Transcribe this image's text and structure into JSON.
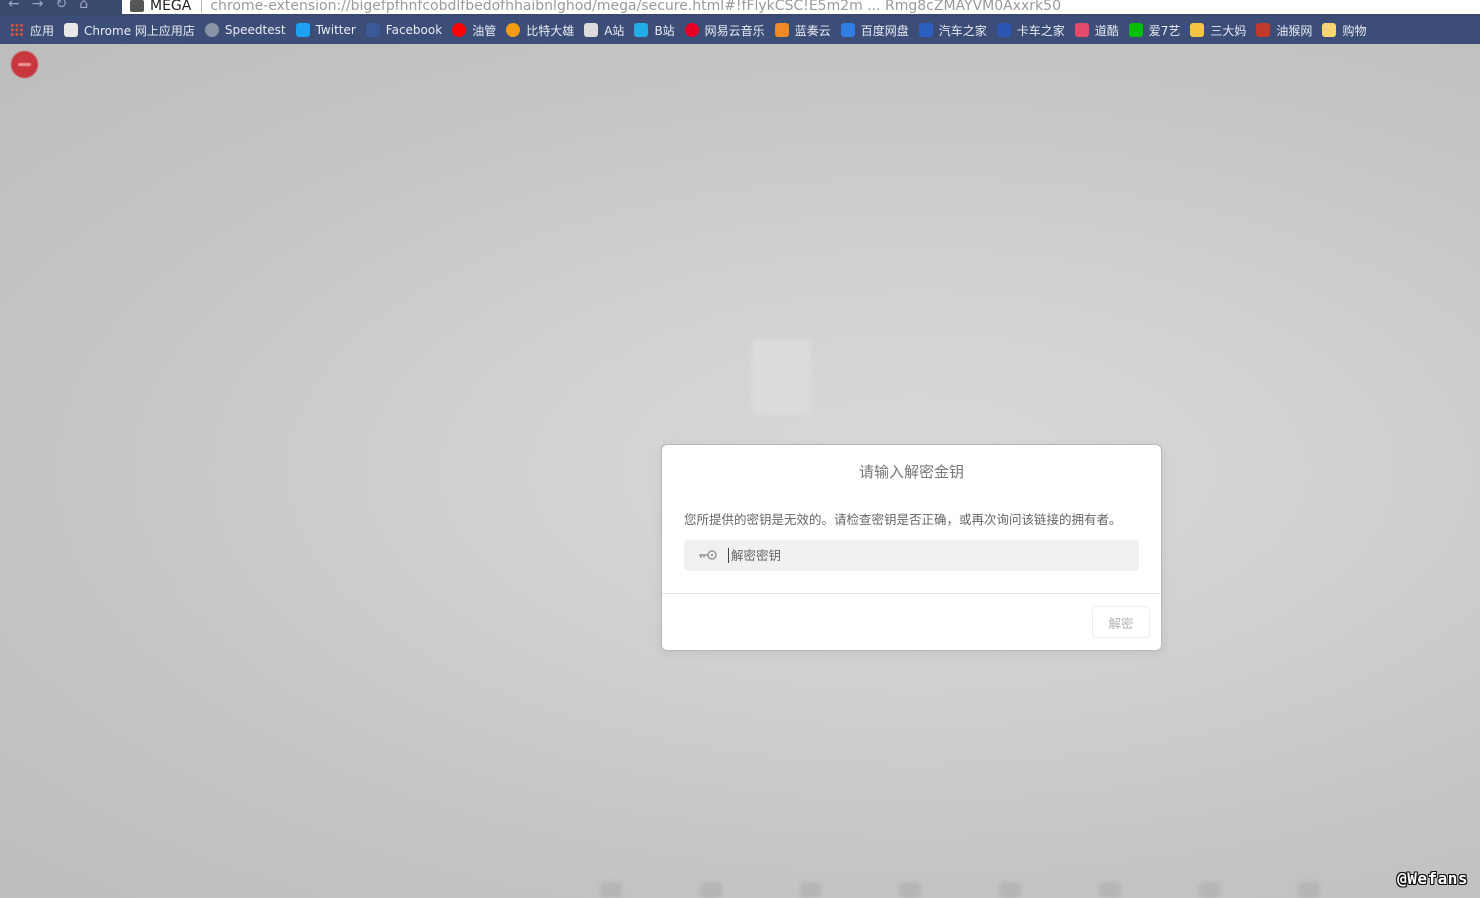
{
  "browser": {
    "tab_title": "MEGA",
    "url": "chrome-extension://bigefpfhnfcobdlfbedofhhaibnlghod/mega/secure.html#!fFlykCSC!E5m2m ... Rmg8cZMAYVM0Axxrk50"
  },
  "bookmarks": [
    {
      "label": "应用",
      "icon": "apps-grid-icon",
      "color": "#e0533d"
    },
    {
      "label": "Chrome 网上应用店",
      "icon": "chrome-webstore-icon",
      "color": "#e8e8e8"
    },
    {
      "label": "Speedtest",
      "icon": "speedtest-icon",
      "color": "#8a93a8"
    },
    {
      "label": "Twitter",
      "icon": "twitter-icon",
      "color": "#1da1f2"
    },
    {
      "label": "Facebook",
      "icon": "facebook-icon",
      "color": "#3b5998"
    },
    {
      "label": "油管",
      "icon": "youtube-icon",
      "color": "#ff0000"
    },
    {
      "label": "比特大雄",
      "icon": "bitdaxiong-icon",
      "color": "#f39c12"
    },
    {
      "label": "A站",
      "icon": "acfun-icon",
      "color": "#dcdcdc"
    },
    {
      "label": "B站",
      "icon": "bilibili-icon",
      "color": "#23ade5"
    },
    {
      "label": "网易云音乐",
      "icon": "netease-music-icon",
      "color": "#e60026"
    },
    {
      "label": "蓝奏云",
      "icon": "lanzou-icon",
      "color": "#f08a24"
    },
    {
      "label": "百度网盘",
      "icon": "baidu-pan-icon",
      "color": "#2f7de1"
    },
    {
      "label": "汽车之家",
      "icon": "autohome-icon",
      "color": "#2b5fbf"
    },
    {
      "label": "卡车之家",
      "icon": "truckhome-icon",
      "color": "#2a56b4"
    },
    {
      "label": "道酷",
      "icon": "daoku-icon",
      "color": "#e64a6b"
    },
    {
      "label": "爱7艺",
      "icon": "iqiyi-icon",
      "color": "#00be06"
    },
    {
      "label": "三大妈",
      "icon": "sandama-icon",
      "color": "#f5c542"
    },
    {
      "label": "油猴网",
      "icon": "youhou-icon",
      "color": "#c0392b"
    },
    {
      "label": "购物",
      "icon": "folder-icon",
      "color": "#f5d76e"
    }
  ],
  "dialog": {
    "title": "请输入解密金钥",
    "message": "您所提供的密钥是无效的。请检查密钥是否正确，或再次询问该链接的拥有者。",
    "key_input": {
      "value": "",
      "placeholder": "解密密钥"
    },
    "decrypt_button": "解密"
  },
  "watermark": "@Wefans"
}
